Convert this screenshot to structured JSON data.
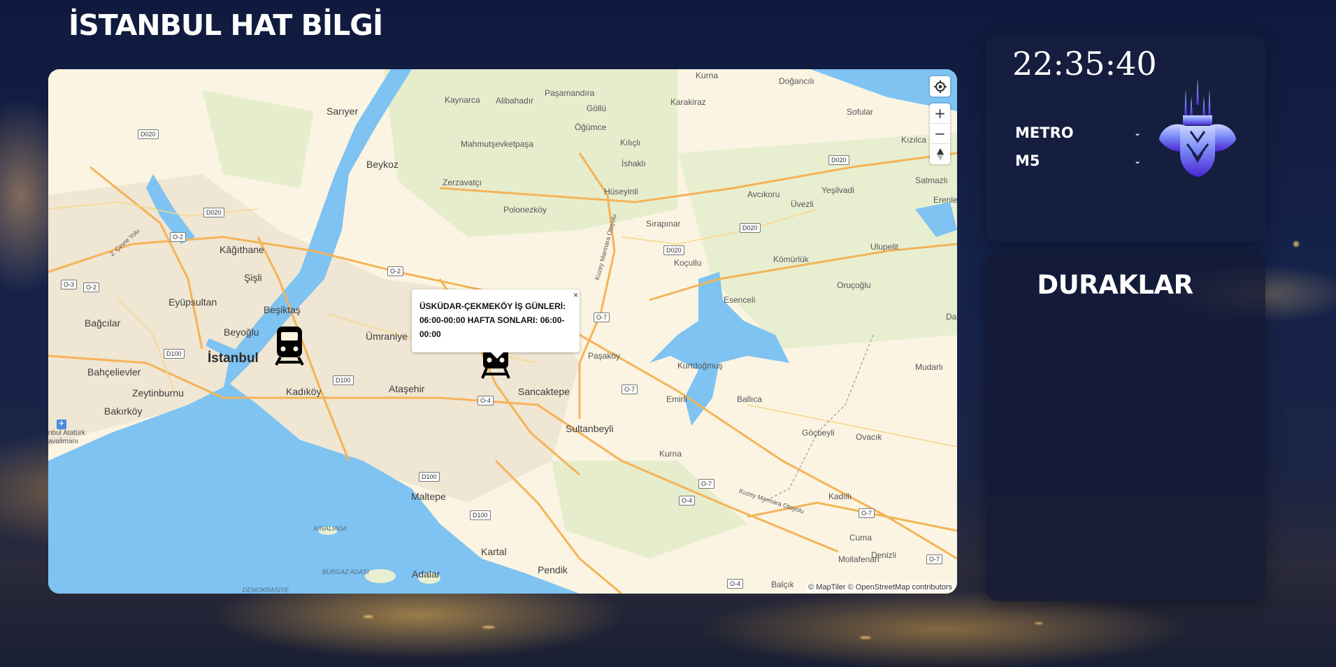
{
  "app": {
    "title": "İSTANBUL HAT BİLGİ"
  },
  "sidebar": {
    "clock": "22:35:40",
    "line_type_select": {
      "selected": "METRO"
    },
    "line_select": {
      "selected": "M5"
    }
  },
  "stops_panel": {
    "title": "DURAKLAR"
  },
  "map": {
    "popup_text": "ÜSKÜDAR-ÇEKMEKÖY İŞ GÜNLERİ: 06:00-00:00 HAFTA SONLARI: 06:00-00:00",
    "popup_close": "×",
    "attribution": "© MapTiler © OpenStreetMap contributors",
    "controls": {
      "zoom_in": "+",
      "zoom_out": "−"
    },
    "places": {
      "kurna_n": "Kurna",
      "dogancili": "Doğancılı",
      "pasamandira": "Paşamandıra",
      "kaynarca": "Kaynarca",
      "alibahadir": "Alibahadır",
      "gollu": "Göllü",
      "karakiraz": "Karakiraz",
      "sariyer": "Sarıyer",
      "sofular": "Sofular",
      "ogumce": "Öğümce",
      "kizilca": "Kızılca",
      "mahmutsevketpasa": "Mahmutşevketpaşa",
      "kilicli": "Kılıçlı",
      "ishakli": "İshaklı",
      "beykoz": "Beykoz",
      "satmazli": "Satmazlı",
      "zerzavatci": "Zerzavatçı",
      "huseyinli": "Hüseyinli",
      "yesilvadi": "Yeşilvadi",
      "avcikoru": "Avcıkoru",
      "uvezli": "Üvezli",
      "erenler": "Erenler",
      "polonezkoy": "Polonezköy",
      "sirapinar": "Sırapınar",
      "kagithane": "Kâğıthane",
      "ulupelit": "Ulupelit",
      "komurluk": "Kömürlük",
      "koculu": "Koçullu",
      "sisli": "Şişli",
      "orucoglu": "Oruçoğlu",
      "esenceli": "Esenceli",
      "eyupsultan": "Eyüpsultan",
      "besiktas": "Beşiktaş",
      "umraniye": "Ümraniye",
      "bagcilar": "Bağcılar",
      "beyoglu": "Beyoğlu",
      "istanbul": "İstanbul",
      "pasakoy": "Paşaköy",
      "kurtdogmus": "Kurtdoğmuş",
      "mudarli": "Mudarlı",
      "bahcelievler": "Bahçelievler",
      "kadikoy": "Kadıköy",
      "atasehir": "Ataşehir",
      "sancaktepe": "Sancaktepe",
      "emirli": "Emirli",
      "ballica": "Ballıca",
      "zeytinburnu": "Zeytinburnu",
      "bakirkoy": "Bakırköy",
      "sultanbeyli": "Sultanbeyli",
      "gocbeyli": "Göçbeyli",
      "ovacik": "Ovacık",
      "ataturk_airport": "nbul Atatürk\navalimanı",
      "kurna_s": "Kurna",
      "maltepe": "Maltepe",
      "kadilli": "Kadıllı",
      "kinaliada": "KINALIADA",
      "cuma": "Cuma",
      "kartal": "Kartal",
      "mollafenari": "Mollafenari",
      "denizli": "Denizli",
      "burgaz": "BURGAZ ADASI",
      "adalar": "Adalar",
      "pendik": "Pendik",
      "balcik": "Balçık",
      "demokrasiye": "DEMOKRASİYE",
      "dar": "Dar",
      "cevre_yolu": "2. Çevre Yolu",
      "kuzey_marmara1": "Kuzey Marmara Otoyolu",
      "kuzey_marmara2": "Kuzey Marmara Otoyolu"
    },
    "road_shields": {
      "d020_a": "D020",
      "d020_b": "D020",
      "d020_c": "D020",
      "d020_d": "D020",
      "d020_e": "D020",
      "o2_a": "O-2",
      "o2_b": "O-2",
      "o2_c": "O-2",
      "o3": "O-3",
      "d100_a": "D100",
      "d100_b": "D100",
      "d100_c": "D100",
      "d100_d": "D100",
      "o4_a": "O-4",
      "o4_b": "O-4",
      "o4_c": "O-4",
      "o7_a": "O-7",
      "o7_b": "O-7",
      "o7_c": "O-7",
      "o7_d": "O-7",
      "o7_e": "O-7"
    }
  },
  "colors": {
    "water": "#7ec3f2",
    "land": "#fbf4e2",
    "park": "#e3ecc9",
    "urban": "#efe6d3",
    "road": "#f6b457",
    "logo_gradient": [
      "#6a7cf5",
      "#4c2bd6"
    ]
  }
}
